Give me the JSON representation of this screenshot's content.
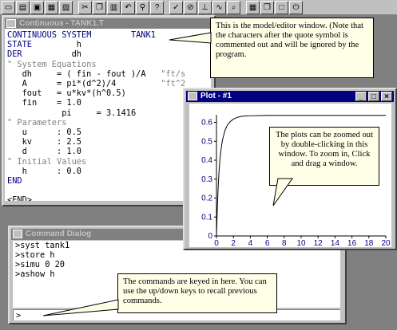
{
  "editor": {
    "title": "Continuous - TANK1.T",
    "lines": [
      {
        "text": "CONTINUOUS SYSTEM",
        "style": "kw"
      },
      {
        "text": "TANK1",
        "style": "kw"
      },
      {
        "text": "STATE",
        "style": "kw"
      },
      {
        "text": "h",
        "style": "plain"
      },
      {
        "text": "DER",
        "style": "kw"
      },
      {
        "text": "dh",
        "style": "plain"
      },
      {
        "text": "\" System Equations",
        "style": "cm"
      },
      {
        "text": "dh     = ( fin - fout )/A",
        "style": "plain"
      },
      {
        "text": "\"ft/s",
        "style": "cm"
      },
      {
        "text": "A      = pi*(d^2)/4",
        "style": "plain"
      },
      {
        "text": "\"ft^2",
        "style": "cm"
      },
      {
        "text": "fout   = u*kv*(h^0.5)",
        "style": "plain"
      },
      {
        "text": "fin    = 1.0",
        "style": "plain"
      },
      {
        "text": "pi     = 3.1416",
        "style": "plain"
      },
      {
        "text": "\" Parameters",
        "style": "cm"
      },
      {
        "text": "u      : 0.5",
        "style": "plain"
      },
      {
        "text": "kv     : 2.5",
        "style": "plain"
      },
      {
        "text": "d      : 1.0",
        "style": "plain"
      },
      {
        "text": "\" Initial Values",
        "style": "cm"
      },
      {
        "text": "h      : 0.0",
        "style": "plain"
      },
      {
        "text": "END",
        "style": "kw"
      },
      {
        "text": "<END>",
        "style": "plain"
      }
    ]
  },
  "editor_callout": "This is the model/editor window. (Note that the characters after the quote symbol is commented out and will be ignored by the program.",
  "plot": {
    "title": "Plot - #1",
    "callout": "The plots can be zoomed out by double-clicking in this window.  To zoom in, Click and drag a window."
  },
  "command": {
    "title": "Command Dialog",
    "history": [
      ">syst tank1",
      ">store h",
      ">simu 0 20",
      ">ashow h"
    ],
    "input": ">",
    "callout": "The commands are keyed in here. You can use the up/down keys to recall previous commands."
  },
  "toolbar": {
    "buttons": [
      "new-icon",
      "open-icon",
      "save-icon",
      "print-icon",
      "lock-icon",
      "cut-icon",
      "copy-icon",
      "paste-icon",
      "undo-icon",
      "find-icon",
      "help-icon",
      "run-icon",
      "stop-icon",
      "axis-icon",
      "plot-icon",
      "zoom-icon",
      "tile-icon",
      "cascade-icon",
      "window-icon",
      "exit-icon"
    ]
  },
  "chart_data": {
    "type": "line",
    "title": "",
    "xlabel": "",
    "ylabel": "",
    "xlim": [
      0,
      20
    ],
    "ylim": [
      0,
      0.64
    ],
    "xticks": [
      0,
      2,
      4,
      6,
      8,
      10,
      12,
      14,
      16,
      18,
      20
    ],
    "yticks": [
      0,
      0.1,
      0.2,
      0.3,
      0.4,
      0.5,
      0.6
    ],
    "series": [
      {
        "color": "#000000",
        "x": [
          0,
          0.1,
          0.2,
          0.3,
          0.4,
          0.5,
          0.7,
          1.0,
          1.3,
          1.6,
          2.0,
          2.5,
          3.0,
          3.5,
          4.0,
          5.0,
          6.0,
          8.0,
          10.0,
          12.0,
          14.0,
          16.0,
          18.0,
          20.0
        ],
        "y": [
          0,
          0.147,
          0.257,
          0.339,
          0.4,
          0.445,
          0.505,
          0.557,
          0.587,
          0.603,
          0.617,
          0.627,
          0.632,
          0.634,
          0.635,
          0.636,
          0.637,
          0.637,
          0.637,
          0.637,
          0.637,
          0.637,
          0.637,
          0.637
        ]
      }
    ]
  }
}
